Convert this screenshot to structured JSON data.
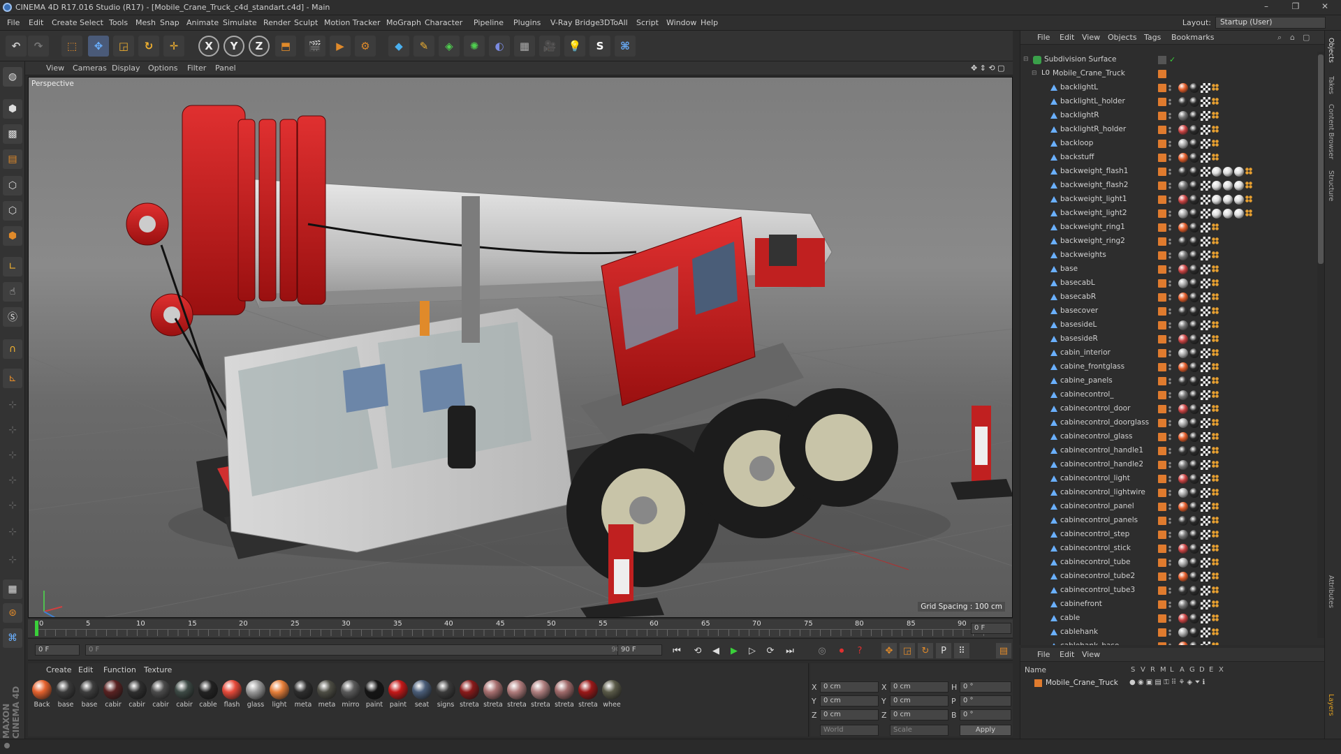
{
  "window": {
    "title": "CINEMA 4D R17.016 Studio (R17) - [Mobile_Crane_Truck_c4d_standart.c4d] - Main",
    "controls": [
      "–",
      "❐",
      "✕"
    ]
  },
  "menubar": {
    "items": [
      "File",
      "Edit",
      "Create",
      "Select",
      "Tools",
      "Mesh",
      "Snap",
      "Animate",
      "Simulate",
      "Render",
      "Sculpt",
      "Motion Tracker",
      "MoGraph",
      "Character",
      "Pipeline",
      "Plugins",
      "V-Ray Bridge",
      "3DToAll",
      "Script",
      "Window",
      "Help"
    ],
    "layout_label": "Layout:",
    "layout_value": "Startup (User)"
  },
  "toolbar": {
    "axis_x": "X",
    "axis_y": "Y",
    "axis_z": "Z"
  },
  "viewport": {
    "menu": [
      "View",
      "Cameras",
      "Display",
      "Options",
      "Filter",
      "Panel"
    ],
    "label": "Perspective",
    "grid_spacing": "Grid Spacing : 100 cm"
  },
  "timeline": {
    "ticks": [
      "0",
      "5",
      "10",
      "15",
      "20",
      "25",
      "30",
      "35",
      "40",
      "45",
      "50",
      "55",
      "60",
      "65",
      "70",
      "75",
      "80",
      "85",
      "90"
    ],
    "current_frame": "0 F"
  },
  "playbar": {
    "start_field": "0 F",
    "range_start": "0 F",
    "range_end": "90 F",
    "end_field": "90 F"
  },
  "materials": {
    "menu": [
      "Create",
      "Edit",
      "Function",
      "Texture"
    ],
    "items": [
      {
        "label": "Back",
        "color": "#e5622e"
      },
      {
        "label": "base",
        "color": "#3a3a3a"
      },
      {
        "label": "base",
        "color": "#3d3d3d"
      },
      {
        "label": "cabir",
        "color": "#5a2222"
      },
      {
        "label": "cabir",
        "color": "#2e2e2e"
      },
      {
        "label": "cabir",
        "color": "#4b4b4b"
      },
      {
        "label": "cabir",
        "color": "#3d4a45"
      },
      {
        "label": "cable",
        "color": "#222222"
      },
      {
        "label": "flash",
        "color": "#e64a3a"
      },
      {
        "label": "glass",
        "color": "#9a9a9a"
      },
      {
        "label": "light",
        "color": "#e8803a"
      },
      {
        "label": "meta",
        "color": "#2d2d2d"
      },
      {
        "label": "meta",
        "color": "#4d4d44"
      },
      {
        "label": "mirro",
        "color": "#5a5a5a"
      },
      {
        "label": "paint",
        "color": "#151515"
      },
      {
        "label": "paint",
        "color": "#c41818"
      },
      {
        "label": "seat",
        "color": "#4a5d78"
      },
      {
        "label": "signs",
        "color": "#3a3a3a"
      },
      {
        "label": "streta",
        "color": "#8a1a1a"
      },
      {
        "label": "streta",
        "color": "#a87070"
      },
      {
        "label": "streta",
        "color": "#b07c7c"
      },
      {
        "label": "streta",
        "color": "#b08080"
      },
      {
        "label": "streta",
        "color": "#a06a6a"
      },
      {
        "label": "streta",
        "color": "#9a1818"
      },
      {
        "label": "whee",
        "color": "#5a5a48"
      }
    ]
  },
  "coords": {
    "x": "0 cm",
    "y": "0 cm",
    "z": "0 cm",
    "x2": "0 cm",
    "y2": "0 cm",
    "z2": "0 cm",
    "h": "0 °",
    "p": "0 °",
    "b": "0 °",
    "mode": "World",
    "mode2": "Scale",
    "apply": "Apply"
  },
  "object_manager": {
    "menu": [
      "File",
      "Edit",
      "View",
      "Objects",
      "Tags",
      "Bookmarks"
    ],
    "root": "Subdivision Surface",
    "group": "Mobile_Crane_Truck",
    "objects": [
      "backlightL",
      "backlightL_holder",
      "backlightR",
      "backlightR_holder",
      "backloop",
      "backstuff",
      "backweight_flash1",
      "backweight_flash2",
      "backweight_light1",
      "backweight_light2",
      "backweight_ring1",
      "backweight_ring2",
      "backweights",
      "base",
      "basecabL",
      "basecabR",
      "basecover",
      "basesideL",
      "basesideR",
      "cabin_interior",
      "cabine_frontglass",
      "cabine_panels",
      "cabinecontrol_",
      "cabinecontrol_door",
      "cabinecontrol_doorglass",
      "cabinecontrol_glass",
      "cabinecontrol_handle1",
      "cabinecontrol_handle2",
      "cabinecontrol_light",
      "cabinecontrol_lightwire",
      "cabinecontrol_panel",
      "cabinecontrol_panels",
      "cabinecontrol_step",
      "cabinecontrol_stick",
      "cabinecontrol_tube",
      "cabinecontrol_tube2",
      "cabinecontrol_tube3",
      "cabinefront",
      "cable",
      "cablehank",
      "cablehank_base"
    ]
  },
  "layers": {
    "menu": [
      "File",
      "Edit",
      "View"
    ],
    "header_name": "Name",
    "columns": [
      "S",
      "V",
      "R",
      "M",
      "L",
      "A",
      "G",
      "D",
      "E",
      "X"
    ],
    "row": "Mobile_Crane_Truck"
  },
  "right_tabs": [
    "Objects",
    "Takes",
    "Content Browser",
    "Structure",
    "Attributes",
    "Layers"
  ],
  "brand": "MAXON CINEMA 4D"
}
